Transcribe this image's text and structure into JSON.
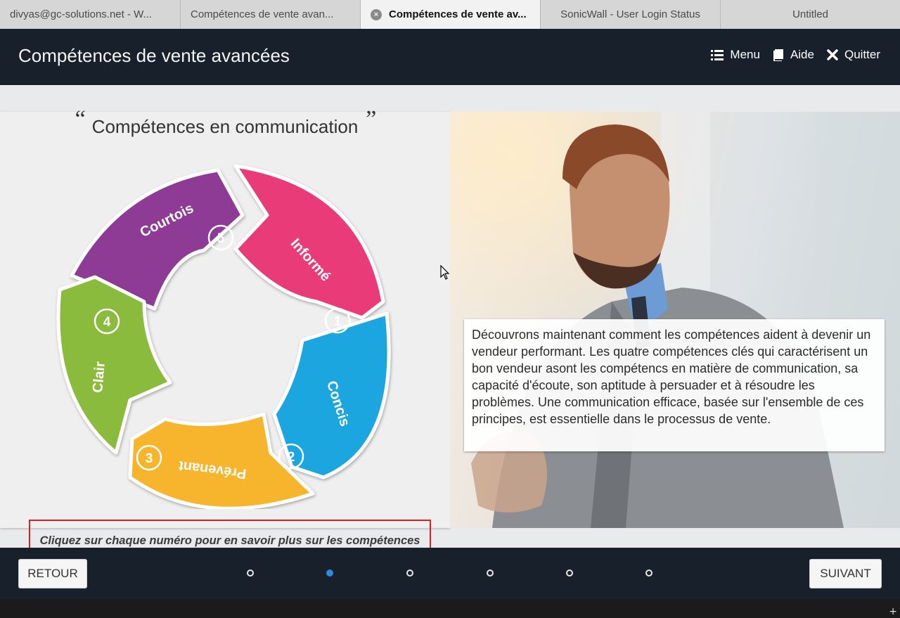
{
  "browser": {
    "tabs": [
      {
        "label": "divyas@gc-solutions.net - W..."
      },
      {
        "label": "Compétences de vente avan..."
      },
      {
        "label": "Compétences de vente av...",
        "close": "×"
      },
      {
        "label": "SonicWall - User Login Status"
      },
      {
        "label": "Untitled"
      }
    ]
  },
  "header": {
    "title": "Compétences de vente avancées",
    "menu_label": "Menu",
    "help_label": "Aide",
    "quit_label": "Quitter"
  },
  "slide": {
    "heading": "Compétences en communication",
    "quote_open": "“",
    "quote_close": "”",
    "wheel": [
      {
        "number": "1",
        "label": "Informé",
        "color": "#e93a78"
      },
      {
        "number": "2",
        "label": "Concis",
        "color": "#1fa6df"
      },
      {
        "number": "3",
        "label": "Prévenant",
        "color": "#f7b52e"
      },
      {
        "number": "4",
        "label": "Clair",
        "color": "#8bbb3c"
      },
      {
        "number": "5",
        "label": "Courtois",
        "color": "#8e3a96"
      }
    ],
    "instruction": "Cliquez sur chaque numéro pour en savoir plus sur les compétences de communication essentielles.",
    "body_text": "Découvrons maintenant comment les compétences aident à devenir un vendeur performant. Les quatre compétences clés qui caractérisent un bon vendeur asont les compétencs en matière de communication, sa capacité d'écoute, son aptitude à persuader et à résoudre les problèmes. Une communication efficace, basée sur l'ensemble de ces principes, est essentielle dans le processus de vente."
  },
  "footer": {
    "prev_label": "RETOUR",
    "next_label": "SUIVANT",
    "pages_total": 6,
    "current_page": 2
  },
  "bottom": {
    "plus": "+"
  },
  "colors": {
    "header_bg": "#18202c",
    "accent_dot": "#2b8be0",
    "instruction_border": "#dc1f1f"
  }
}
